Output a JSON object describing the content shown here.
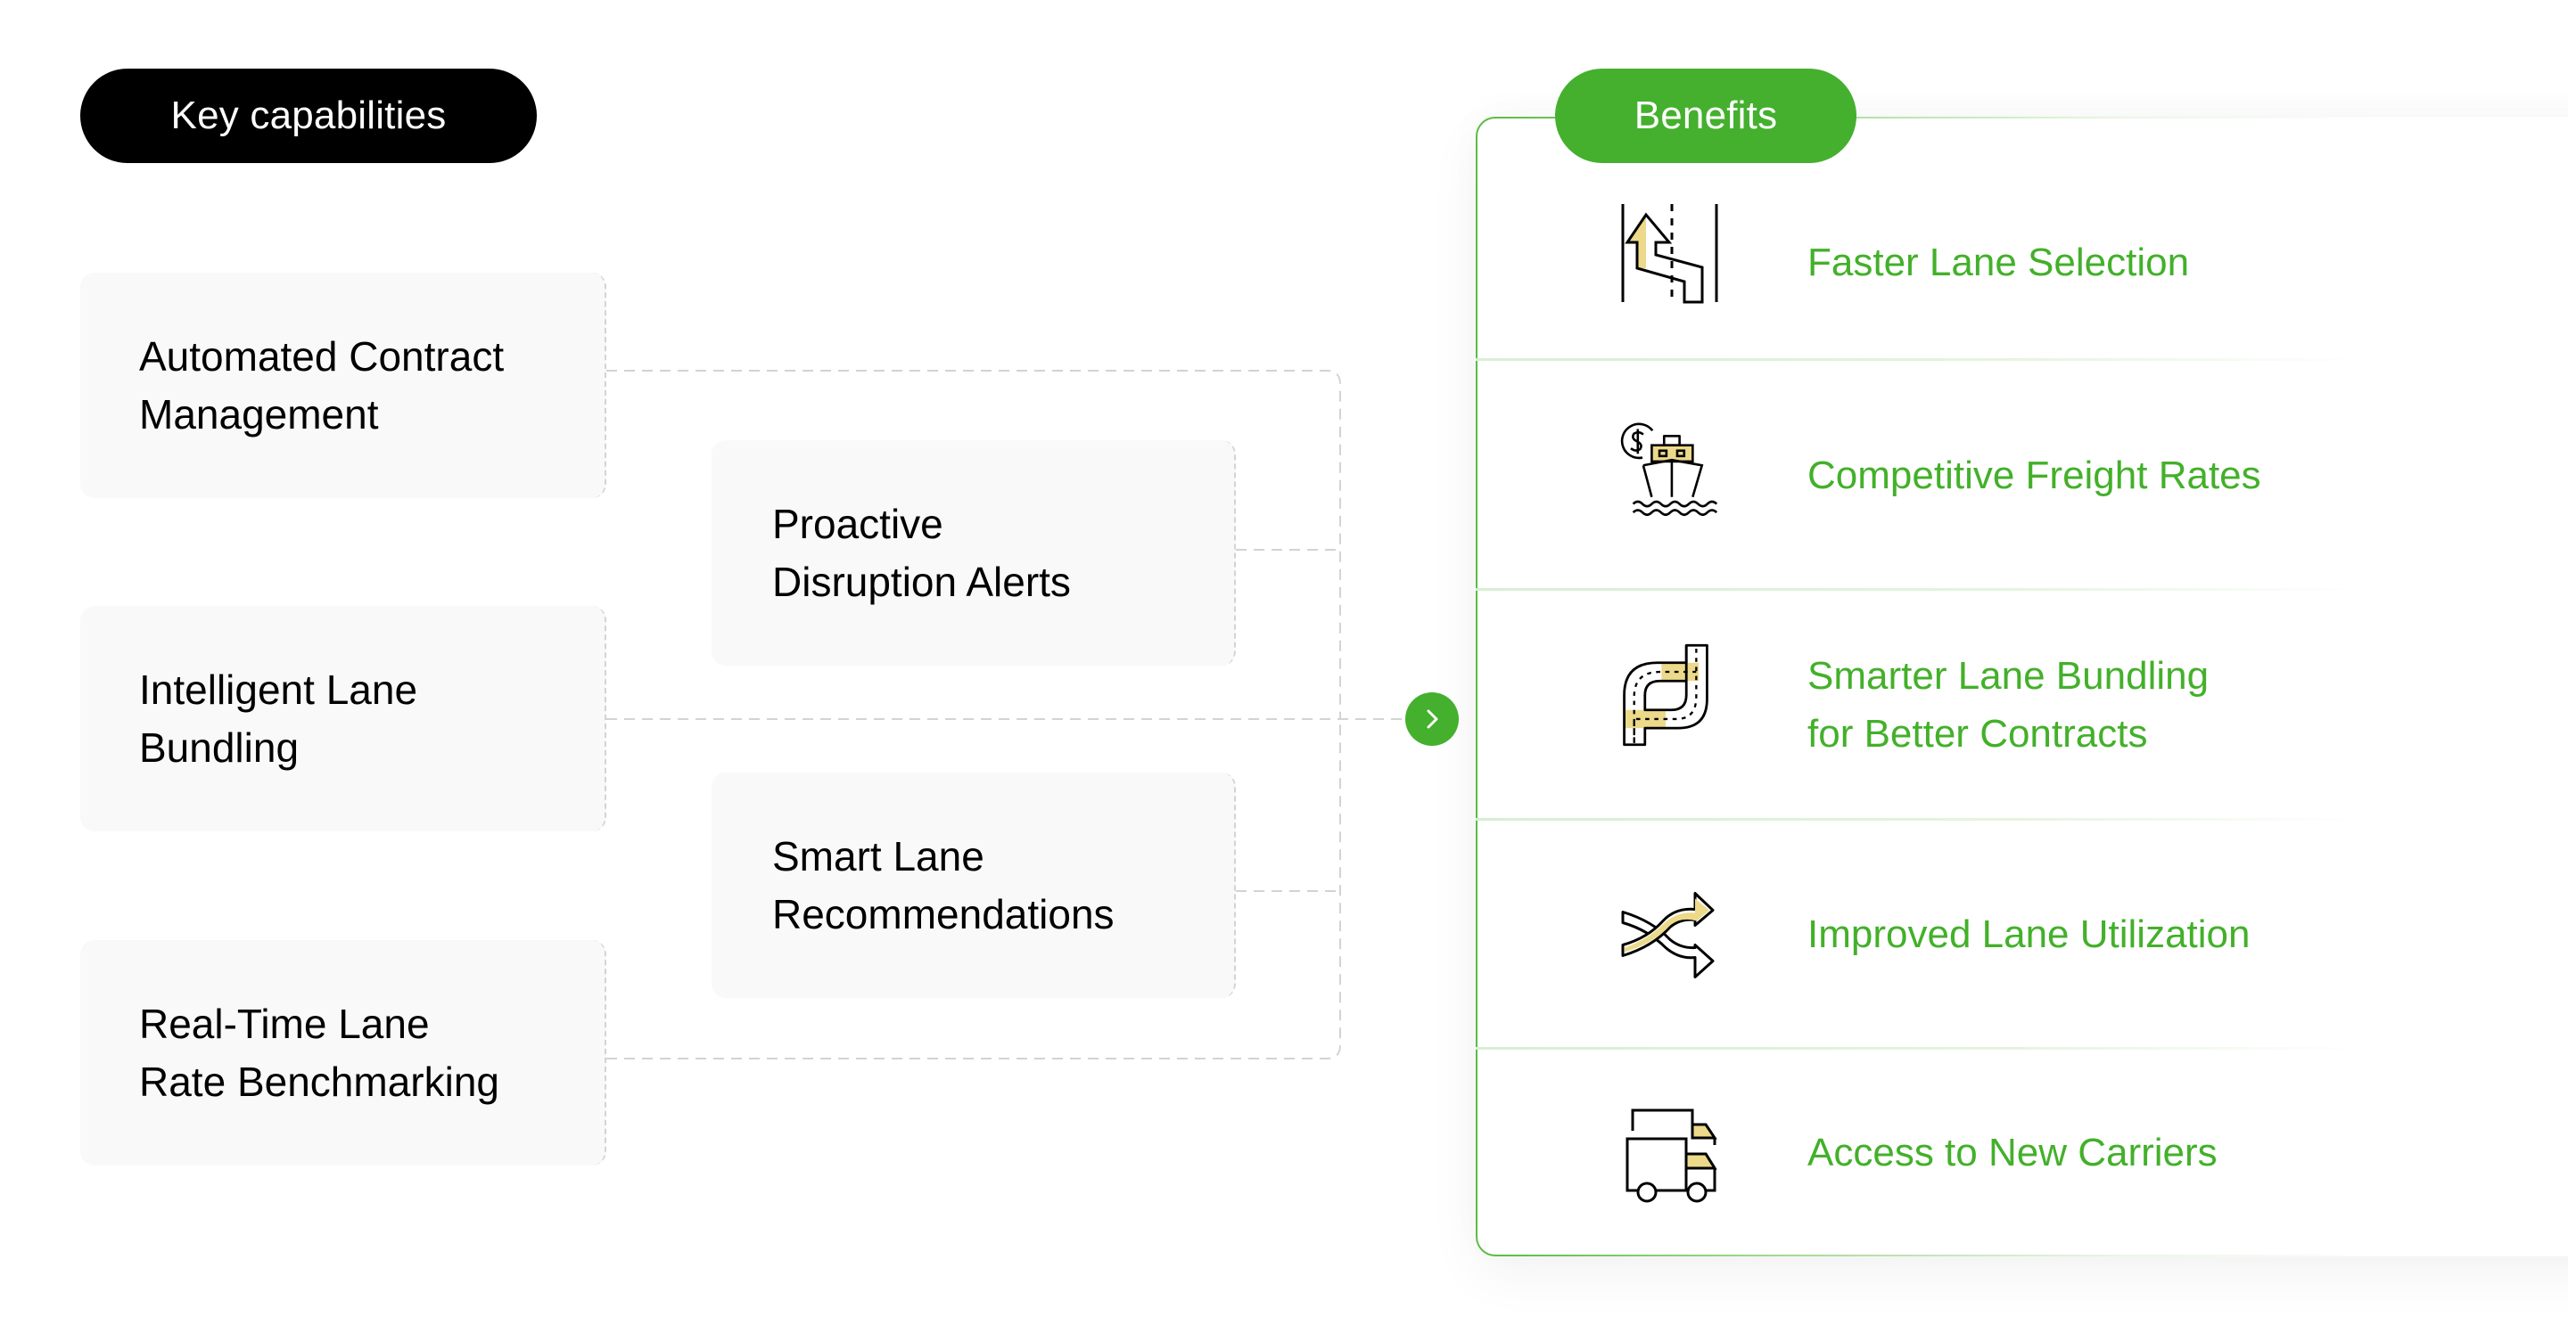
{
  "capabilities_header": {
    "label": "Key capabilities",
    "color": "#000000"
  },
  "benefits_header": {
    "label": "Benefits",
    "color": "#44b02e"
  },
  "capabilities": [
    {
      "id": "automated-contract-management",
      "label": "Automated Contract\nManagement"
    },
    {
      "id": "intelligent-lane-bundling",
      "label": "Intelligent Lane\nBundling"
    },
    {
      "id": "real-time-lane-rate-benchmarking",
      "label": "Real-Time Lane\nRate Benchmarking"
    },
    {
      "id": "proactive-disruption-alerts",
      "label": "Proactive\nDisruption Alerts"
    },
    {
      "id": "smart-lane-recommendations",
      "label": "Smart Lane\nRecommendations"
    }
  ],
  "connector": {
    "icon": "chevron-right-icon",
    "color": "#44b02e"
  },
  "benefits": [
    {
      "icon": "lane-change-arrow-icon",
      "label": "Faster Lane Selection"
    },
    {
      "icon": "ship-dollar-icon",
      "label": "Competitive Freight Rates"
    },
    {
      "icon": "winding-road-icon",
      "label": "Smarter Lane Bundling\nfor Better Contracts"
    },
    {
      "icon": "shuffle-arrows-icon",
      "label": "Improved Lane Utilization"
    },
    {
      "icon": "trucks-icon",
      "label": "Access to New Carriers"
    }
  ],
  "colors": {
    "accent_green": "#44b02e",
    "benefit_text": "#43b02a",
    "icon_highlight": "#ecd98a",
    "card_bg": "#f9f9f9",
    "dashed_line": "#d3d3d3"
  }
}
